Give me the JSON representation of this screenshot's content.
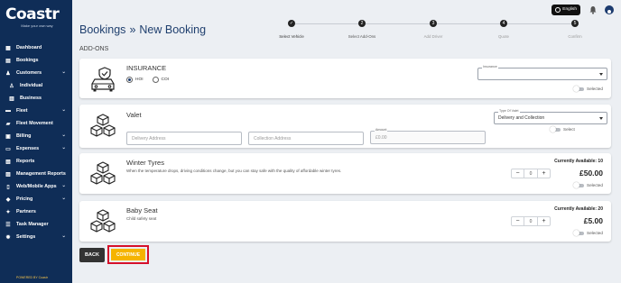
{
  "brand": {
    "logo_text": "Coastr",
    "tagline": "Make your own way",
    "powered_by": "POWERED BY Coastr"
  },
  "sidebar": {
    "items": [
      {
        "label": "Dashboard",
        "icon": "dashboard-icon",
        "chevron": false
      },
      {
        "label": "Bookings",
        "icon": "bookings-icon",
        "chevron": false
      },
      {
        "label": "Customers",
        "icon": "customers-icon",
        "chevron": true
      },
      {
        "label": "Individual",
        "icon": "person-icon",
        "chevron": false,
        "sub": true
      },
      {
        "label": "Business",
        "icon": "building-icon",
        "chevron": false,
        "sub": true
      },
      {
        "label": "Fleet",
        "icon": "car-icon",
        "chevron": true
      },
      {
        "label": "Fleet Movement",
        "icon": "truck-icon",
        "chevron": false
      },
      {
        "label": "Billing",
        "icon": "billing-icon",
        "chevron": true
      },
      {
        "label": "Expenses",
        "icon": "wallet-icon",
        "chevron": true
      },
      {
        "label": "Reports",
        "icon": "reports-icon",
        "chevron": false
      },
      {
        "label": "Management Reports",
        "icon": "chart-icon",
        "chevron": false
      },
      {
        "label": "Web/Mobile Apps",
        "icon": "apps-icon",
        "chevron": true
      },
      {
        "label": "Pricing",
        "icon": "tag-icon",
        "chevron": true
      },
      {
        "label": "Partners",
        "icon": "handshake-icon",
        "chevron": false
      },
      {
        "label": "Task Manager",
        "icon": "tasks-icon",
        "chevron": false
      },
      {
        "label": "Settings",
        "icon": "gear-icon",
        "chevron": true
      }
    ]
  },
  "header": {
    "title_part1": "Bookings",
    "title_sep": "»",
    "title_part2": "New  Booking",
    "language": "English"
  },
  "steps": [
    {
      "label": "Select Vehicle",
      "marker": "✓",
      "state": "done"
    },
    {
      "label": "Select Add-Ons",
      "marker": "2",
      "state": "current"
    },
    {
      "label": "Add Driver",
      "marker": "3",
      "state": "todo"
    },
    {
      "label": "Quote",
      "marker": "4",
      "state": "todo"
    },
    {
      "label": "Confirm",
      "marker": "5",
      "state": "todo"
    }
  ],
  "section_title": "ADD-ONS",
  "insurance": {
    "title": "INSURANCE",
    "options": [
      {
        "label": "HOI",
        "selected": true
      },
      {
        "label": "COI",
        "selected": false
      }
    ],
    "select_label": "Insurance",
    "select_value": "",
    "toggle_label": "Selected"
  },
  "valet": {
    "title": "Valet",
    "type_label": "Type Of Valet",
    "type_value": "Delivery and Collection",
    "toggle_label": "Select",
    "delivery_placeholder": "Delivery Address",
    "collection_placeholder": "Collection Address",
    "amount_label": "Amount",
    "amount_value": "£0.00"
  },
  "winter_tyres": {
    "title": "Winter Tyres",
    "description": "When the temperature drops, driving conditions change, but you can stay safe with the quality of affordable winter tyres.",
    "available": "Currently Available: 10",
    "price": "£50.00",
    "quantity": "0",
    "toggle_label": "Selected"
  },
  "baby_seat": {
    "title": "Baby Seat",
    "description": "Child safety seat",
    "available": "Currently Available: 20",
    "price": "£5.00",
    "quantity": "0",
    "toggle_label": "Selected"
  },
  "actions": {
    "back": "BACK",
    "continue": "CONTINUE"
  },
  "colors": {
    "sidebar": "#0f2d57",
    "title": "#1f3f6e",
    "continue": "#f5b400",
    "highlight": "#d6102b"
  }
}
